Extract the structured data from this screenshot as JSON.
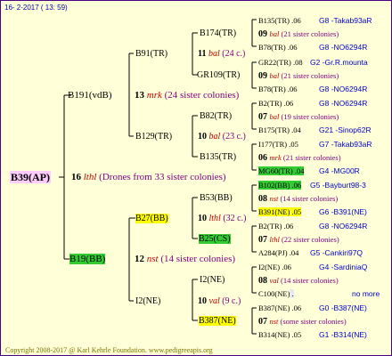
{
  "header": "16- 2-2017 ( 13: 59)",
  "footer": "Copyright 2008-2017 @ Karl Kehrle Foundation.   www.pedigreeapis.org",
  "root": {
    "label": "B39(AP)",
    "gen_num": "16",
    "race": "lthl",
    "desc": "(Drones from 33 sister colonies)"
  },
  "sire": {
    "label": "B191(vdB)",
    "gen_num": "13",
    "race": "mrk",
    "desc": "(24 sister colonies)"
  },
  "dam": {
    "label": "B19(BB)",
    "gen_num": "12",
    "race": "nst",
    "desc": "(14 sister colonies)"
  },
  "ss": {
    "label": "B91(TR)",
    "gen_num": "11",
    "race": "bal",
    "desc": "(24 c.)"
  },
  "sd": {
    "label": "B129(TR)",
    "gen_num": "10",
    "race": "bal",
    "desc": "(23 c.)"
  },
  "ds": {
    "label": "B27(BB)",
    "gen_num": "10",
    "race": "lthl",
    "desc": "(32 c.)"
  },
  "dd": {
    "label": "I2(NE)",
    "gen_num": "10",
    "race": "val",
    "desc": "(9 c.)"
  },
  "sss": {
    "label": "B174(TR)"
  },
  "ssd": {
    "label": "GR109(TR)"
  },
  "sds": {
    "label": "B82(TR)"
  },
  "sdd": {
    "label": "B135(TR)"
  },
  "dss": {
    "label": "B53(BB)"
  },
  "dsd": {
    "label": "B25(CS)"
  },
  "dds": {
    "label": "I2(NE)"
  },
  "ddd": {
    "label": "B387(NE)"
  },
  "g4": [
    {
      "name": "B135(TR)",
      "val": ".06",
      "ref": "G8 -Takab93aR"
    },
    {
      "num": "09",
      "race": "bal",
      "desc": "(21 sister colonies)"
    },
    {
      "name": "B78(TR)",
      "val": ".06",
      "ref": "G8 -NO6294R"
    },
    {
      "name": "GR22(TR)",
      "val": ".08",
      "ref": "G2 -Gr.R.mounta"
    },
    {
      "num": "09",
      "race": "bal",
      "desc": "(21 sister colonies)"
    },
    {
      "name": "B78(TR)",
      "val": ".06",
      "ref": "G8 -NO6294R"
    },
    {
      "name": "B2(TR)",
      "val": ".06",
      "ref": "G8 -NO6294R"
    },
    {
      "num": "07",
      "race": "bal",
      "desc": "(19 sister colonies)"
    },
    {
      "name": "B175(TR)",
      "val": ".04",
      "ref": "G21 -Sinop62R"
    },
    {
      "name": "I177(TR)",
      "val": ".05",
      "ref": "G7 -Takab93aR"
    },
    {
      "num": "06",
      "race": "mrk",
      "desc": "(21 sister colonies)"
    },
    {
      "name": "MG60(TR)",
      "val": ".04",
      "ref": "G4 -MG00R"
    },
    {
      "name": "B102(BB)",
      "val": ".06",
      "ref": "G5 -Bayburt98-3"
    },
    {
      "num": "08",
      "race": "nst",
      "desc": "(14 sister colonies)"
    },
    {
      "name": "B391(NE)",
      "val": ".05",
      "ref": "G6 -B391(NE)"
    },
    {
      "name": "B2(TR)",
      "val": ".06",
      "ref": "G8 -NO6294R"
    },
    {
      "num": "07",
      "race": "lthl",
      "desc": "(22 sister colonies)"
    },
    {
      "name": "A284(PJ)",
      "val": ".04",
      "ref": "G5 -Cankiri97Q"
    },
    {
      "name": "I2(NE)",
      "val": ".06",
      "ref": "G4 -SardiniaQ"
    },
    {
      "num": "08",
      "race": "val",
      "desc": "(14 sister colonies)"
    },
    {
      "name": "C100(NE)",
      "val": ".",
      "ref": "no more"
    },
    {
      "name": "B387(NE)",
      "val": ".06",
      "ref": "G0 -B387(NE)"
    },
    {
      "num": "07",
      "race": "nst",
      "desc": "(some sister colonies)"
    },
    {
      "name": "B314(NE)",
      "val": ".05",
      "ref": "G1 -B314(NE)"
    }
  ]
}
